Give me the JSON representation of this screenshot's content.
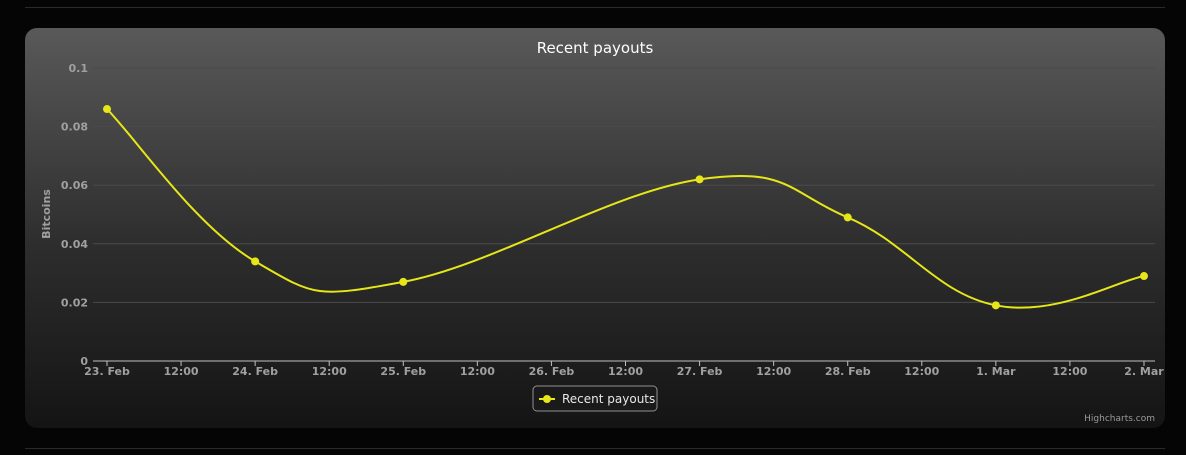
{
  "chart_data": {
    "type": "line",
    "title": "Recent payouts",
    "xlabel": "",
    "ylabel": "Bitcoins",
    "ylim": [
      0,
      0.1
    ],
    "y_ticks": [
      0,
      0.02,
      0.04,
      0.06,
      0.08,
      0.1
    ],
    "x_range": [
      "23. Feb",
      "2. Mar"
    ],
    "x_ticks": [
      "23. Feb",
      "12:00",
      "24. Feb",
      "12:00",
      "25. Feb",
      "12:00",
      "26. Feb",
      "12:00",
      "27. Feb",
      "12:00",
      "28. Feb",
      "12:00",
      "1. Mar",
      "12:00",
      "2. Mar"
    ],
    "grid": true,
    "legend_position": "bottom-center",
    "series": [
      {
        "name": "Recent payouts",
        "color": "#e6e619",
        "x": [
          "23. Feb",
          "24. Feb",
          "25. Feb",
          "27. Feb",
          "28. Feb",
          "1. Mar",
          "2. Mar"
        ],
        "values": [
          0.086,
          0.034,
          0.027,
          0.062,
          0.049,
          0.019,
          0.029
        ]
      }
    ]
  },
  "credit": "Highcharts.com",
  "colors": {
    "panel_top": "#595959",
    "panel_bottom": "#141414",
    "grid": "#4a4a4a",
    "tick_label": "#a0a0a0",
    "title": "#ffffff"
  }
}
